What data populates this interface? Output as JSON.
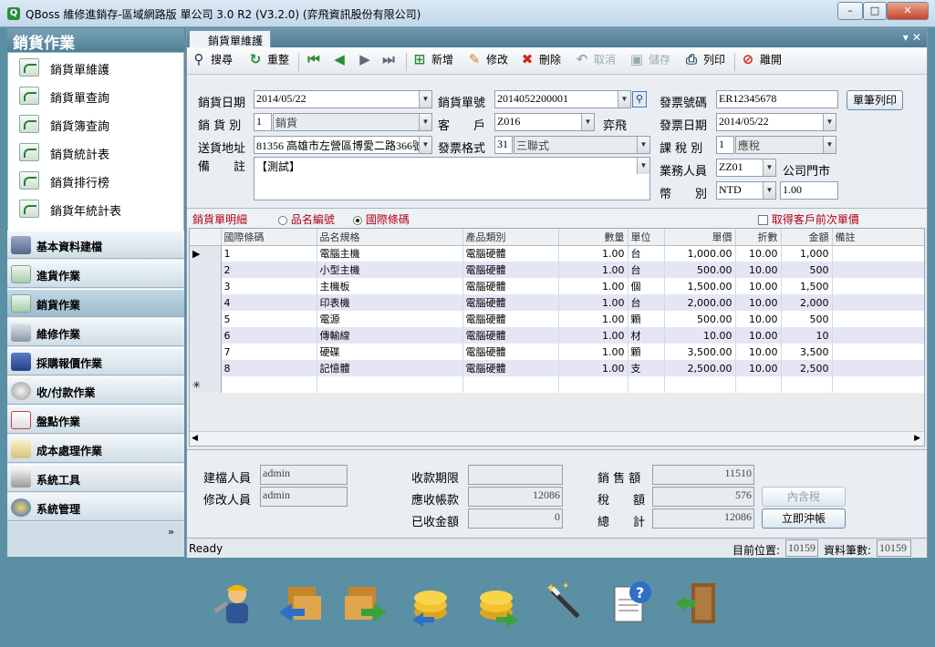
{
  "window": {
    "title": "QBoss 維修進銷存-區域網路版 單公司 3.0 R2 (V3.2.0) (弈飛資訊股份有限公司)",
    "app_icon": "Q",
    "minimize": "–",
    "maximize": "□",
    "close": "✕"
  },
  "sidebar": {
    "header": "銷貨作業",
    "items": [
      {
        "label": "銷貨單維護"
      },
      {
        "label": "銷貨單查詢"
      },
      {
        "label": "銷貨簿查詢"
      },
      {
        "label": "銷貨統計表"
      },
      {
        "label": "銷貨排行榜"
      },
      {
        "label": "銷貨年統計表"
      }
    ],
    "nav": [
      {
        "label": "基本資料建檔"
      },
      {
        "label": "進貨作業"
      },
      {
        "label": "銷貨作業"
      },
      {
        "label": "維修作業"
      },
      {
        "label": "採購報價作業"
      },
      {
        "label": "收/付款作業"
      },
      {
        "label": "盤點作業"
      },
      {
        "label": "成本處理作業"
      },
      {
        "label": "系統工具"
      },
      {
        "label": "系統管理"
      }
    ],
    "expand": "»"
  },
  "tab": {
    "label": "銷貨單維護",
    "controls": "▾ ✕"
  },
  "toolbar": {
    "search": "搜尋",
    "reset": "重整",
    "new": "新增",
    "edit": "修改",
    "delete": "刪除",
    "cancel": "取消",
    "save": "儲存",
    "print": "列印",
    "exit": "離開"
  },
  "form": {
    "sale_date_label": "銷貨日期",
    "sale_date": "2014/05/22",
    "sale_no_label": "銷貨單號",
    "sale_no": "2014052200001",
    "invoice_no_label": "發票號碼",
    "invoice_no": "ER12345678",
    "print_single_btn": "單筆列印",
    "sale_type_label": "銷 貨 別",
    "sale_type_code": "1",
    "sale_type_name": "銷貨",
    "customer_label": "客　　戶",
    "customer_code": "Z016",
    "customer_name": "弈飛",
    "invoice_date_label": "發票日期",
    "invoice_date": "2014/05/22",
    "address_label": "送貨地址",
    "address": "81356 高雄市左營區博愛二路366號",
    "invoice_format_label": "發票格式",
    "invoice_format_code": "31",
    "invoice_format_name": "三聯式",
    "tax_type_label": "課 稅 別",
    "tax_type_code": "1",
    "tax_type_name": "應稅",
    "remark_label": "備　　註",
    "remark": "【測試】",
    "salesperson_label": "業務人員",
    "salesperson_code": "ZZ01",
    "salesperson_name": "公司門市",
    "currency_label": "幣　　別",
    "currency": "NTD",
    "rate": "1.00"
  },
  "detail": {
    "title": "銷貨單明細",
    "radio1": "品名編號",
    "radio2": "國際條碼",
    "check_label": "取得客戶前次單價",
    "columns": [
      "國際條碼",
      "品名規格",
      "產品類別",
      "數量",
      "單位",
      "單價",
      "折數",
      "金額",
      "備註"
    ],
    "rows": [
      [
        "1",
        "電腦主機",
        "電腦硬體",
        "1.00",
        "台",
        "1,000.00",
        "10.00",
        "1,000",
        ""
      ],
      [
        "2",
        "小型主機",
        "電腦硬體",
        "1.00",
        "台",
        "500.00",
        "10.00",
        "500",
        ""
      ],
      [
        "3",
        "主機板",
        "電腦硬體",
        "1.00",
        "個",
        "1,500.00",
        "10.00",
        "1,500",
        ""
      ],
      [
        "4",
        "印表機",
        "電腦硬體",
        "1.00",
        "台",
        "2,000.00",
        "10.00",
        "2,000",
        ""
      ],
      [
        "5",
        "電源",
        "電腦硬體",
        "1.00",
        "顆",
        "500.00",
        "10.00",
        "500",
        ""
      ],
      [
        "6",
        "傳輸線",
        "電腦硬體",
        "1.00",
        "材",
        "10.00",
        "10.00",
        "10",
        ""
      ],
      [
        "7",
        "硬碟",
        "電腦硬體",
        "1.00",
        "顆",
        "3,500.00",
        "10.00",
        "3,500",
        ""
      ],
      [
        "8",
        "記憶體",
        "電腦硬體",
        "1.00",
        "支",
        "2,500.00",
        "10.00",
        "2,500",
        ""
      ]
    ],
    "row_pointer": "▶",
    "new_row_marker": "✳"
  },
  "footer": {
    "creator_label": "建檔人員",
    "creator": "admin",
    "modifier_label": "修改人員",
    "modifier": "admin",
    "due_label": "收款期限",
    "due": "",
    "receivable_label": "應收帳款",
    "receivable": "12086",
    "received_label": "已收金額",
    "received": "0",
    "sales_label": "銷 售 額",
    "sales": "11510",
    "tax_label": "稅　　額",
    "tax": "576",
    "total_label": "總　　計",
    "total": "12086",
    "tax_incl_btn": "內含稅",
    "settle_btn": "立即沖帳"
  },
  "status": {
    "text": "Ready",
    "pos_label": "目前位置:",
    "pos": "10159",
    "count_label": "資料筆數:",
    "count": "10159"
  }
}
